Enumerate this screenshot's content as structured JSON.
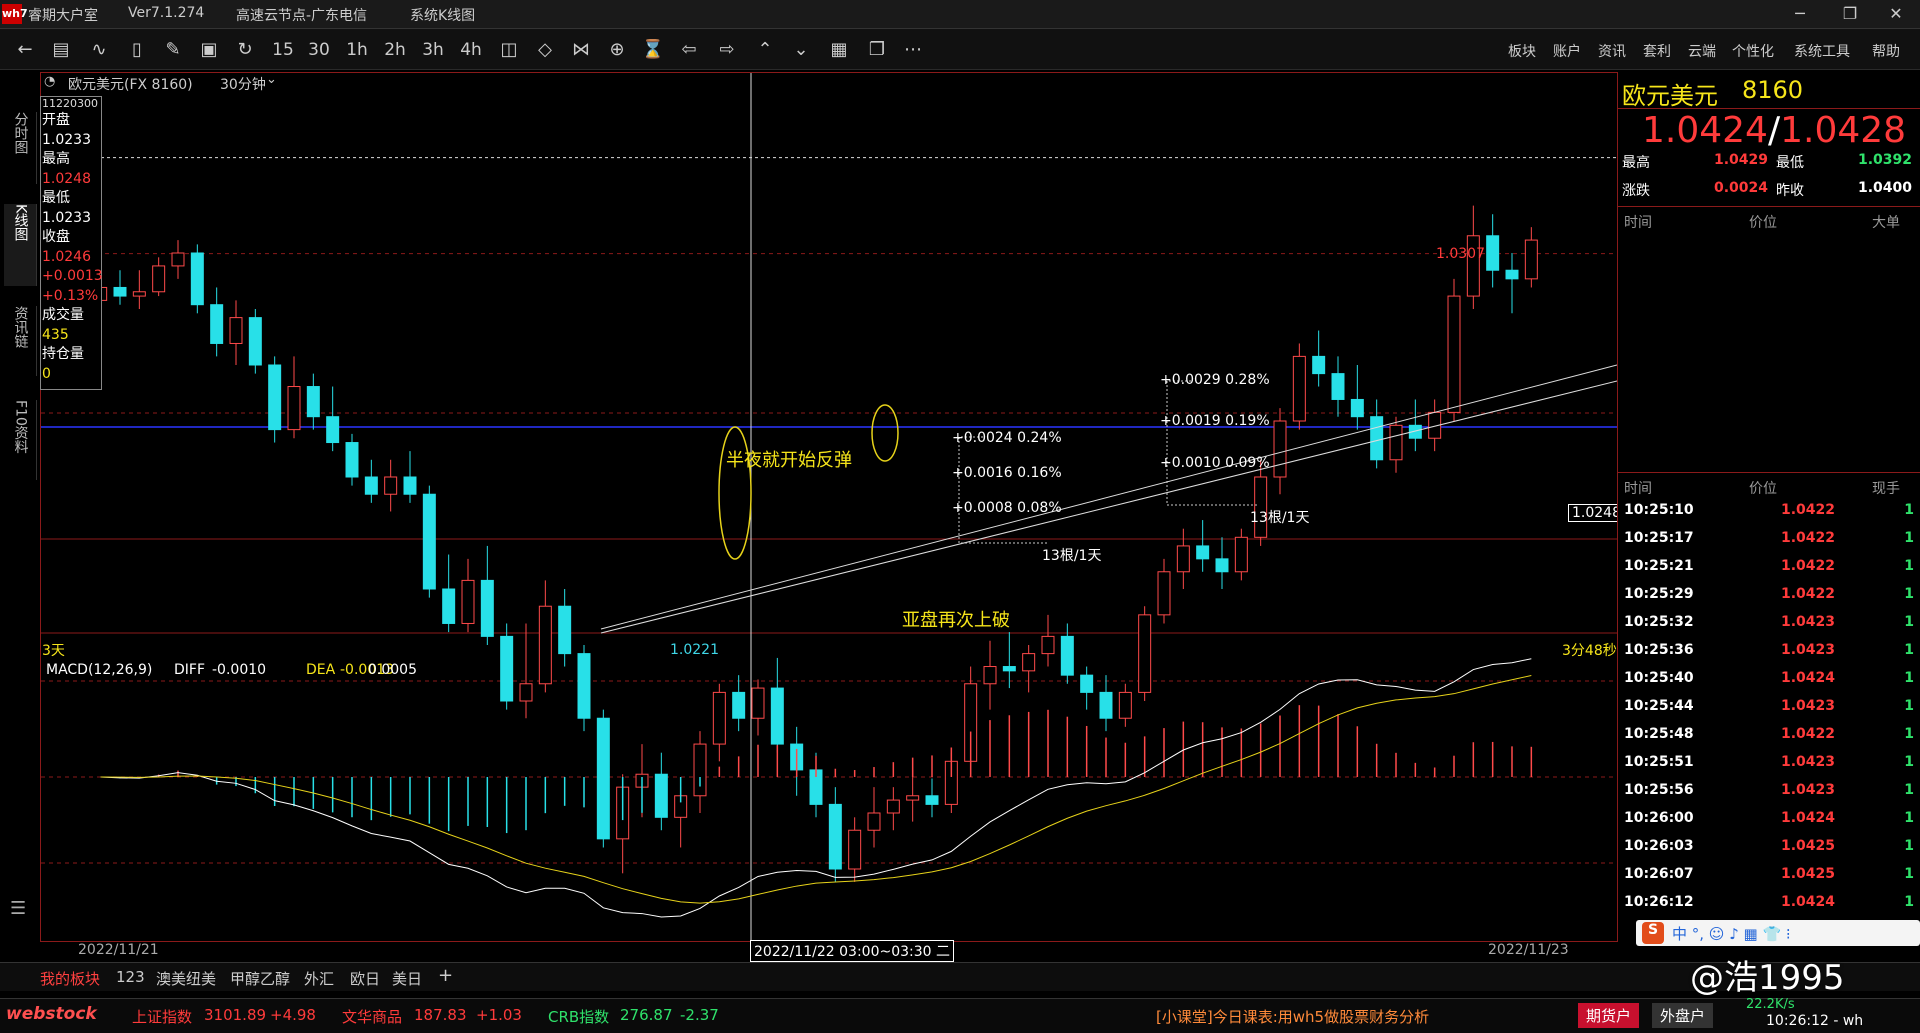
{
  "window": {
    "app_name": "睿期大户室",
    "version": "Ver7.1.274",
    "server": "高速云节点-广东电信",
    "view": "系统K线图",
    "controls": [
      "─",
      "❐",
      "✕"
    ]
  },
  "toolbar": {
    "icons": [
      "back-icon",
      "table-icon",
      "line-chart-icon",
      "candle-icon",
      "drawing-icon",
      "save-icon",
      "refresh-icon"
    ],
    "periods": [
      "15",
      "30",
      "1h",
      "2h",
      "3h",
      "4h"
    ],
    "menu": [
      "板块",
      "账户",
      "资讯",
      "套利",
      "云端",
      "个性化",
      "系统工具",
      "帮助"
    ]
  },
  "left_tabs": [
    "分时图",
    "K线图",
    "资讯链",
    "F10资料"
  ],
  "chart": {
    "symbol_label": "欧元美元(FX 8160)",
    "period": "30分钟",
    "ohlc": {
      "time": "11220300",
      "open_label": "开盘",
      "open": "1.0233",
      "high_label": "最高",
      "high": "1.0248",
      "low_label": "最低",
      "low": "1.0233",
      "close_label": "收盘",
      "close": "1.0246",
      "change": "+0.0013",
      "change_pct": "+0.13%",
      "volume_label": "成交量",
      "volume": "435",
      "oi_label": "持仓量",
      "oi": "0"
    },
    "high_mark": "1.0307",
    "low_mark": "1.0221",
    "price_tag": "1.0248",
    "countdown_left": "3天",
    "countdown_right": "3分48秒",
    "annotation_1": "半夜就开始反弹",
    "annotation_2": "亚盘再次上破",
    "fib_1": [
      "+0.0024  0.24%",
      "+0.0016  0.16%",
      "+0.0008  0.08%"
    ],
    "fib_1_footer": "13根/1天",
    "fib_2": [
      "+0.0029  0.28%",
      "+0.0019  0.19%",
      "+0.0010  0.09%"
    ],
    "fib_2_footer": "13根/1天",
    "macd": {
      "label": "MACD(12,26,9)",
      "diff_label": "DIFF",
      "diff": "-0.0010",
      "dea_label": "DEA",
      "dea": "-0.0013",
      "macd": "0.0005"
    },
    "x_labels": [
      "2022/11/21",
      "2022/11/22 03:00~03:30 二",
      "2022/11/23"
    ]
  },
  "chart_data": {
    "type": "candlestick",
    "title": "欧元美元(FX 8160) 30分钟",
    "high_mark": 1.0307,
    "low_mark": 1.0221,
    "ylim": [
      1.0205,
      1.0335
    ],
    "candles": [
      [
        1.0285,
        1.029,
        1.0282,
        1.0288
      ],
      [
        1.0288,
        1.0292,
        1.0284,
        1.0286
      ],
      [
        1.0286,
        1.0292,
        1.0283,
        1.0287
      ],
      [
        1.0287,
        1.0295,
        1.0286,
        1.0293
      ],
      [
        1.0293,
        1.0299,
        1.029,
        1.0296
      ],
      [
        1.0296,
        1.0298,
        1.0282,
        1.0284
      ],
      [
        1.0284,
        1.0288,
        1.0272,
        1.0275
      ],
      [
        1.0275,
        1.0285,
        1.027,
        1.0281
      ],
      [
        1.0281,
        1.0283,
        1.0268,
        1.027
      ],
      [
        1.027,
        1.0272,
        1.0252,
        1.0255
      ],
      [
        1.0255,
        1.0272,
        1.0253,
        1.0265
      ],
      [
        1.0265,
        1.0268,
        1.0255,
        1.0258
      ],
      [
        1.0258,
        1.0265,
        1.025,
        1.0252
      ],
      [
        1.0252,
        1.0254,
        1.0242,
        1.0244
      ],
      [
        1.0244,
        1.0248,
        1.0238,
        1.024
      ],
      [
        1.024,
        1.0248,
        1.0236,
        1.0244
      ],
      [
        1.0244,
        1.025,
        1.0238,
        1.024
      ],
      [
        1.024,
        1.0242,
        1.0216,
        1.0218
      ],
      [
        1.0218,
        1.0226,
        1.0208,
        1.021
      ],
      [
        1.021,
        1.0225,
        1.0208,
        1.022
      ],
      [
        1.022,
        1.0228,
        1.0205,
        1.0207
      ],
      [
        1.0207,
        1.021,
        1.019,
        1.0192
      ],
      [
        1.0192,
        1.021,
        1.0188,
        1.0196
      ],
      [
        1.0196,
        1.022,
        1.0194,
        1.0214
      ],
      [
        1.0214,
        1.0218,
        1.02,
        1.0203
      ],
      [
        1.0203,
        1.0205,
        1.0185,
        1.0188
      ],
      [
        1.0188,
        1.019,
        1.0158,
        1.016
      ],
      [
        1.016,
        1.0175,
        1.0152,
        1.0172
      ],
      [
        1.0172,
        1.0182,
        1.0165,
        1.0175
      ],
      [
        1.0175,
        1.018,
        1.0162,
        1.0165
      ],
      [
        1.0165,
        1.0172,
        1.0158,
        1.017
      ],
      [
        1.017,
        1.0185,
        1.0166,
        1.0182
      ],
      [
        1.0182,
        1.0196,
        1.0178,
        1.0194
      ],
      [
        1.0194,
        1.0198,
        1.0185,
        1.0188
      ],
      [
        1.0188,
        1.0197,
        1.0184,
        1.0195
      ],
      [
        1.0195,
        1.0202,
        1.018,
        1.0182
      ],
      [
        1.0182,
        1.0186,
        1.017,
        1.0176
      ],
      [
        1.0176,
        1.018,
        1.0165,
        1.0168
      ],
      [
        1.0168,
        1.0172,
        1.015,
        1.0153
      ],
      [
        1.0153,
        1.0165,
        1.015,
        1.0162
      ],
      [
        1.0162,
        1.0172,
        1.0158,
        1.0166
      ],
      [
        1.0166,
        1.0172,
        1.0162,
        1.0169
      ],
      [
        1.0169,
        1.0176,
        1.0164,
        1.017
      ],
      [
        1.017,
        1.0174,
        1.0165,
        1.0168
      ],
      [
        1.0168,
        1.018,
        1.0166,
        1.0178
      ],
      [
        1.0178,
        1.02,
        1.0175,
        1.0196
      ],
      [
        1.0196,
        1.0206,
        1.019,
        1.02
      ],
      [
        1.02,
        1.0208,
        1.0195,
        1.0199
      ],
      [
        1.0199,
        1.0205,
        1.0194,
        1.0203
      ],
      [
        1.0203,
        1.0212,
        1.02,
        1.0207
      ],
      [
        1.0207,
        1.021,
        1.0196,
        1.0198
      ],
      [
        1.0198,
        1.02,
        1.019,
        1.0194
      ],
      [
        1.0194,
        1.0198,
        1.0185,
        1.0188
      ],
      [
        1.0188,
        1.0196,
        1.0186,
        1.0194
      ],
      [
        1.0194,
        1.0214,
        1.0192,
        1.0212
      ],
      [
        1.0212,
        1.0225,
        1.021,
        1.0222
      ],
      [
        1.0222,
        1.0232,
        1.0218,
        1.0228
      ],
      [
        1.0228,
        1.0234,
        1.0222,
        1.0225
      ],
      [
        1.0225,
        1.023,
        1.0218,
        1.0222
      ],
      [
        1.0222,
        1.0232,
        1.022,
        1.023
      ],
      [
        1.023,
        1.0248,
        1.0228,
        1.0244
      ],
      [
        1.0244,
        1.026,
        1.024,
        1.0257
      ],
      [
        1.0257,
        1.0275,
        1.0255,
        1.0272
      ],
      [
        1.0272,
        1.0278,
        1.0265,
        1.0268
      ],
      [
        1.0268,
        1.0272,
        1.0258,
        1.0262
      ],
      [
        1.0262,
        1.027,
        1.0255,
        1.0258
      ],
      [
        1.0258,
        1.0262,
        1.0246,
        1.0248
      ],
      [
        1.0248,
        1.0258,
        1.0245,
        1.0256
      ],
      [
        1.0256,
        1.0262,
        1.025,
        1.0253
      ],
      [
        1.0253,
        1.0262,
        1.025,
        1.0259
      ],
      [
        1.0259,
        1.029,
        1.0257,
        1.0286
      ],
      [
        1.0286,
        1.0307,
        1.0283,
        1.03
      ],
      [
        1.03,
        1.0305,
        1.0288,
        1.0292
      ],
      [
        1.0292,
        1.0296,
        1.0282,
        1.029
      ],
      [
        1.029,
        1.0302,
        1.0288,
        1.0299
      ]
    ]
  },
  "quote_panel": {
    "title": "欧元美元",
    "code": "8160",
    "bid": "1.0424",
    "ask": "1.0428",
    "high_label": "最高",
    "high": "1.0429",
    "low_label": "最低",
    "low": "1.0392",
    "change_label": "涨跌",
    "change": "0.0024",
    "prev_label": "昨收",
    "prev": "1.0400",
    "big_headers": [
      "时间",
      "价位",
      "大单"
    ],
    "tick_headers": [
      "时间",
      "价位",
      "现手"
    ],
    "ticks": [
      {
        "time": "10:25:10",
        "price": "1.0422",
        "vol": "1"
      },
      {
        "time": "10:25:17",
        "price": "1.0422",
        "vol": "1"
      },
      {
        "time": "10:25:21",
        "price": "1.0422",
        "vol": "1"
      },
      {
        "time": "10:25:29",
        "price": "1.0422",
        "vol": "1"
      },
      {
        "time": "10:25:32",
        "price": "1.0423",
        "vol": "1"
      },
      {
        "time": "10:25:36",
        "price": "1.0423",
        "vol": "1"
      },
      {
        "time": "10:25:40",
        "price": "1.0424",
        "vol": "1"
      },
      {
        "time": "10:25:44",
        "price": "1.0423",
        "vol": "1"
      },
      {
        "time": "10:25:48",
        "price": "1.0422",
        "vol": "1"
      },
      {
        "time": "10:25:51",
        "price": "1.0423",
        "vol": "1"
      },
      {
        "time": "10:25:56",
        "price": "1.0423",
        "vol": "1"
      },
      {
        "time": "10:26:00",
        "price": "1.0424",
        "vol": "1"
      },
      {
        "time": "10:26:03",
        "price": "1.0425",
        "vol": "1"
      },
      {
        "time": "10:26:07",
        "price": "1.0425",
        "vol": "1"
      },
      {
        "time": "10:26:12",
        "price": "1.0424",
        "vol": "1"
      }
    ]
  },
  "bottom_tabs": [
    "我的板块",
    "123",
    "澳美纽美",
    "甲醇乙醇",
    "外汇",
    "欧日",
    "美日",
    "+"
  ],
  "status": {
    "brand": "webstock",
    "idx1_name": "上证指数",
    "idx1_val": "3101.89",
    "idx1_chg": "+4.98",
    "idx2_name": "文华商品",
    "idx2_val": "187.83",
    "idx2_chg": "+1.03",
    "idx3_name": "CRB指数",
    "idx3_val": "276.87",
    "idx3_chg": "-2.37",
    "ticker": "[小课堂]今日课表:用wh5做股票财务分析",
    "btn1": "期货户",
    "btn2": "外盘户",
    "clock": "10:26:12 - wh",
    "speed": "22.2K/s",
    "watermark": "@浩1995"
  }
}
